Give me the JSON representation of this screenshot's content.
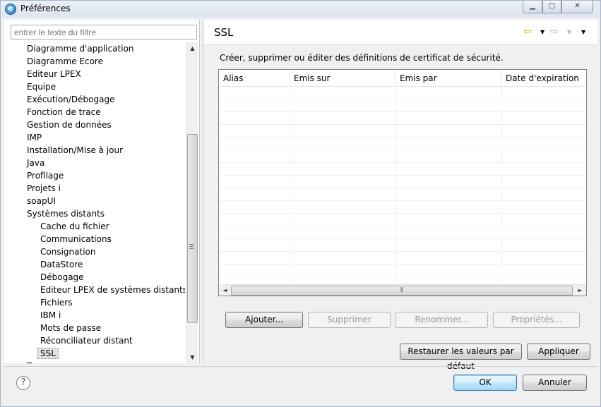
{
  "window": {
    "title": "Préférences",
    "minimize_label": "▁",
    "maximize_label": "▢",
    "close_label": "✕"
  },
  "filter": {
    "placeholder": "entrer le texte du filtre"
  },
  "tree": {
    "items": [
      {
        "label": "Diagramme d'application",
        "level": 1
      },
      {
        "label": "Diagramme Ecore",
        "level": 1
      },
      {
        "label": "Editeur LPEX",
        "level": 1
      },
      {
        "label": "Equipe",
        "level": 1
      },
      {
        "label": "Exécution/Débogage",
        "level": 1
      },
      {
        "label": "Fonction de trace",
        "level": 1
      },
      {
        "label": "Gestion de données",
        "level": 1
      },
      {
        "label": "IMP",
        "level": 1
      },
      {
        "label": "Installation/Mise à jour",
        "level": 1
      },
      {
        "label": "Java",
        "level": 1
      },
      {
        "label": "Profilage",
        "level": 1
      },
      {
        "label": "Projets i",
        "level": 1
      },
      {
        "label": "soapUI",
        "level": 1
      },
      {
        "label": "Systèmes distants",
        "level": 1
      },
      {
        "label": "Cache du fichier",
        "level": 2
      },
      {
        "label": "Communications",
        "level": 2
      },
      {
        "label": "Consignation",
        "level": 2
      },
      {
        "label": "DataStore",
        "level": 2
      },
      {
        "label": "Débogage",
        "level": 2
      },
      {
        "label": "Editeur LPEX de systèmes distants",
        "level": 2
      },
      {
        "label": "Fichiers",
        "level": 2
      },
      {
        "label": "IBM i",
        "level": 2
      },
      {
        "label": "Mots de passe",
        "level": 2
      },
      {
        "label": "Réconciliateur distant",
        "level": 2
      },
      {
        "label": "SSL",
        "level": 2,
        "selected": true
      },
      {
        "label": "Te",
        "level": 1
      }
    ]
  },
  "page": {
    "title": "SSL",
    "description": "Créer, supprimer ou éditer des définitions de certificat de sécurité.",
    "nav_back_icon": "back-arrow-icon",
    "nav_forward_icon": "forward-arrow-icon"
  },
  "table": {
    "columns": [
      "Alias",
      "Emis sur",
      "Emis par",
      "Date d'expiration"
    ],
    "rows": []
  },
  "buttons": {
    "add": "Ajouter...",
    "remove": "Supprimer",
    "rename": "Renommer...",
    "properties": "Propriétés...",
    "restore_defaults": "Restaurer les valeurs par défaut",
    "apply": "Appliquer",
    "ok": "OK",
    "cancel": "Annuler"
  },
  "colors": {
    "accent": "#3c7fb1",
    "nav_back": "#e1a400"
  }
}
